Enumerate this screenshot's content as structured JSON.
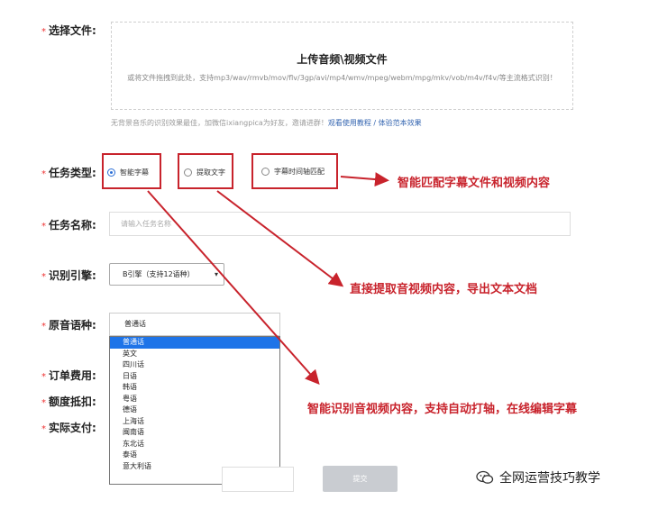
{
  "form": {
    "required_mark": "*",
    "labels": {
      "file": "选择文件:",
      "task_type": "任务类型:",
      "task_name": "任务名称:",
      "engine": "识别引擎:",
      "language": "原音语种:",
      "order_fee": "订单费用:",
      "quota": "额度抵扣:",
      "actual_pay": "实际支付:"
    },
    "upload": {
      "title": "上传音频\\视频文件",
      "hint": "或将文件拖拽到此处，支持mp3/wav/rmvb/mov/flv/3gp/avi/mp4/wmv/mpeg/webm/mpg/mkv/vob/m4v/f4v/等主流格式识别！"
    },
    "note": {
      "text": "无背景音乐的识别效果最佳，加微信ixiangpica为好友，邀请进群！",
      "link1": "观看使用教程",
      "sep": " / ",
      "link2": "体验范本效果"
    },
    "task_types": [
      {
        "label": "智能字幕",
        "checked": true
      },
      {
        "label": "提取文字",
        "checked": false
      },
      {
        "label": "字幕时间轴匹配",
        "checked": false
      }
    ],
    "task_name_placeholder": "请输入任务名称",
    "engine_value": "B引擎（支持12语种）",
    "language_value": "普通话",
    "language_options": [
      "普通话",
      "英文",
      "四川话",
      "日语",
      "韩语",
      "粤语",
      "德语",
      "上海话",
      "闽南语",
      "东北话",
      "泰语",
      "意大利语"
    ],
    "selected_language_index": 0,
    "submit_label": "提交"
  },
  "annotations": {
    "a1": "智能匹配字幕文件和视频内容",
    "a2": "直接提取音视频内容，导出文本文档",
    "a3": "智能识别音视频内容，支持自动打轴，在线编辑字幕"
  },
  "watermark": "全网运营技巧教学",
  "colors": {
    "annotation_red": "#c8232c",
    "selected_option_blue": "#1e74e8",
    "link_blue": "#3465b0"
  }
}
